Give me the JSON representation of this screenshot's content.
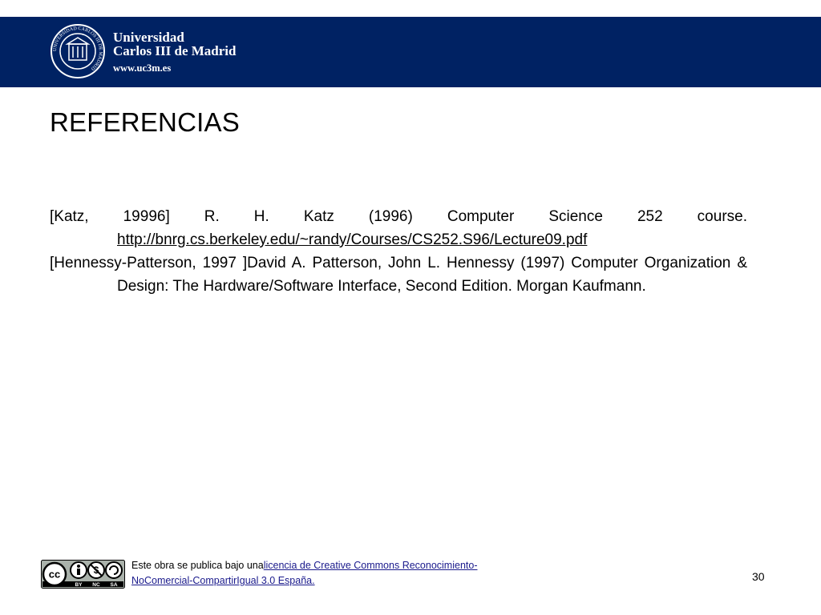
{
  "header": {
    "university_line1": "Universidad",
    "university_line2": "Carlos III de Madrid",
    "website": "www.uc3m.es",
    "seal_text": "UNIVERSIDAD CARLOS III DE MADRID",
    "colors": {
      "bar": "#002263",
      "text": "#ffffff"
    }
  },
  "title": "REFERENCIAS",
  "references": [
    {
      "text": "[Katz, 19996] R. H. Katz (1996) Computer Science 252 course.",
      "link": "http://bnrg.cs.berkeley.edu/~randy/Courses/CS252.S96/Lecture09.pdf"
    },
    {
      "text": "[Hennessy-Patterson, 1997 ]David A. Patterson, John L. Hennessy (1997) Computer Organization & Design: The Hardware/Software Interface, Second Edition. Morgan Kaufmann."
    }
  ],
  "footer": {
    "badge_labels": [
      "cc",
      "BY",
      "NC",
      "SA"
    ],
    "license_prefix": "Este obra se publica bajo una",
    "license_link_line1": "licencia de Creative Commons Reconocimiento-",
    "license_link_line2": "NoComercial-CompartirIgual 3.0 España.",
    "page_number": "30"
  }
}
